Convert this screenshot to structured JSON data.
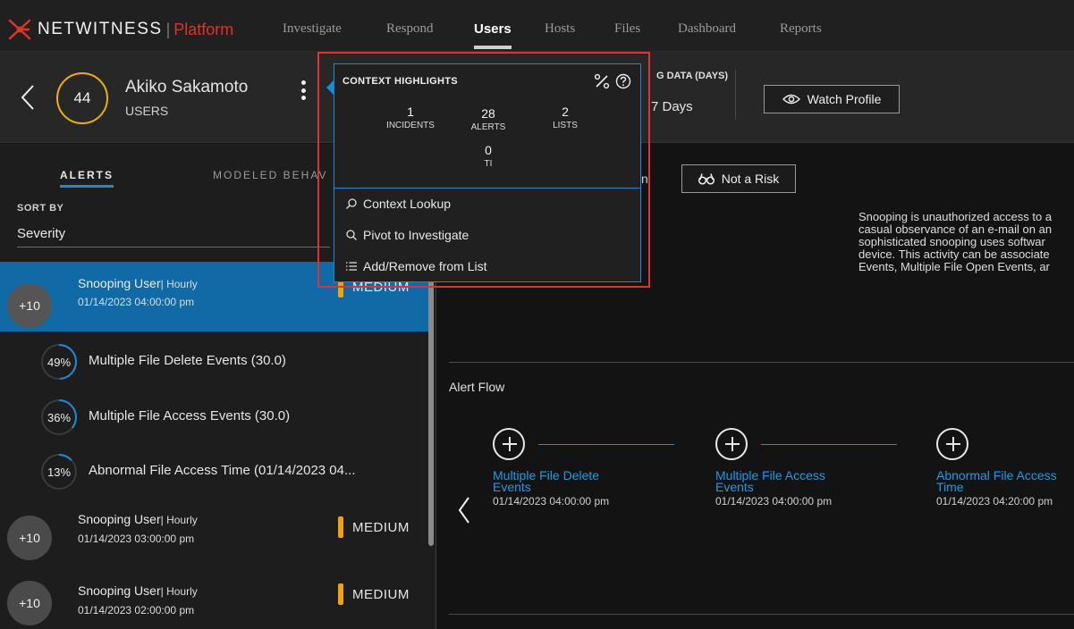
{
  "nav": {
    "brand_name": "NETWITNESS",
    "brand_sep": "|",
    "brand_product": "Platform",
    "items": [
      {
        "label": "Investigate"
      },
      {
        "label": "Respond"
      },
      {
        "label": "Users"
      },
      {
        "label": "Hosts"
      },
      {
        "label": "Files"
      },
      {
        "label": "Dashboard"
      },
      {
        "label": "Reports"
      }
    ],
    "active": "Users"
  },
  "user": {
    "score": "44",
    "name": "Akiko Sakamoto",
    "type": "USERS",
    "modeled_label": "G DATA (DAYS)",
    "modeled_value": "7 Days",
    "watch_button": "Watch Profile"
  },
  "tabs": {
    "alerts": "ALERTS",
    "modeled": "MODELED BEHAV"
  },
  "sort": {
    "label": "SORT BY",
    "value": "Severity"
  },
  "alerts": [
    {
      "badge": "+10",
      "title": "Snooping User",
      "freq": "| Hourly",
      "date": "01/14/2023 04:00:00 pm",
      "severity": "MEDIUM",
      "selected": true
    },
    {
      "badge": "+10",
      "title": "Snooping User",
      "freq": "| Hourly",
      "date": "01/14/2023 03:00:00 pm",
      "severity": "MEDIUM",
      "selected": false
    },
    {
      "badge": "+10",
      "title": "Snooping User",
      "freq": "| Hourly",
      "date": "01/14/2023 02:00:00 pm",
      "severity": "MEDIUM",
      "selected": false
    }
  ],
  "indicators": [
    {
      "percent": "49%",
      "fraction": 0.49,
      "label": "Multiple File Delete Events (30.0)"
    },
    {
      "percent": "36%",
      "fraction": 0.36,
      "label": "Multiple File Access Events (30.0)"
    },
    {
      "percent": "13%",
      "fraction": 0.13,
      "label": "Abnormal File Access Time (01/14/2023 04..."
    }
  ],
  "detail": {
    "not_risk_button": "Not a Risk",
    "cut_text": "n",
    "description_lines": [
      "Snooping is unauthorized access to a",
      "casual observance of an e-mail on an",
      "sophisticated snooping uses softwar",
      "device. This activity can be associate",
      "Events, Multiple File Open Events, ar"
    ]
  },
  "flow": {
    "title": "Alert Flow",
    "nodes": [
      {
        "name": "Multiple File Delete Events",
        "date": "01/14/2023 04:00:00 pm"
      },
      {
        "name": "Multiple File Access Events",
        "date": "01/14/2023 04:00:00 pm"
      },
      {
        "name": "Abnormal File Access Time",
        "date": "01/14/2023 04:20:00 pm"
      }
    ]
  },
  "popup": {
    "title": "CONTEXT HIGHLIGHTS",
    "metrics": [
      {
        "num": "1",
        "label": "INCIDENTS"
      },
      {
        "num": "28",
        "label": "ALERTS"
      },
      {
        "num": "2",
        "label": "LISTS"
      },
      {
        "num": "0",
        "label": "TI"
      }
    ],
    "menu": [
      {
        "label": "Context Lookup",
        "icon": "context-lookup-icon"
      },
      {
        "label": "Pivot to Investigate",
        "icon": "search-icon"
      },
      {
        "label": "Add/Remove from List",
        "icon": "list-icon"
      }
    ]
  },
  "colors": {
    "accent": "#1f8ad4",
    "selected_row": "#0f6aa6",
    "severity_medium": "#f1a20c",
    "score_ring": "#f0b400",
    "brand_red": "#e0332a",
    "callout": "#e03232"
  }
}
